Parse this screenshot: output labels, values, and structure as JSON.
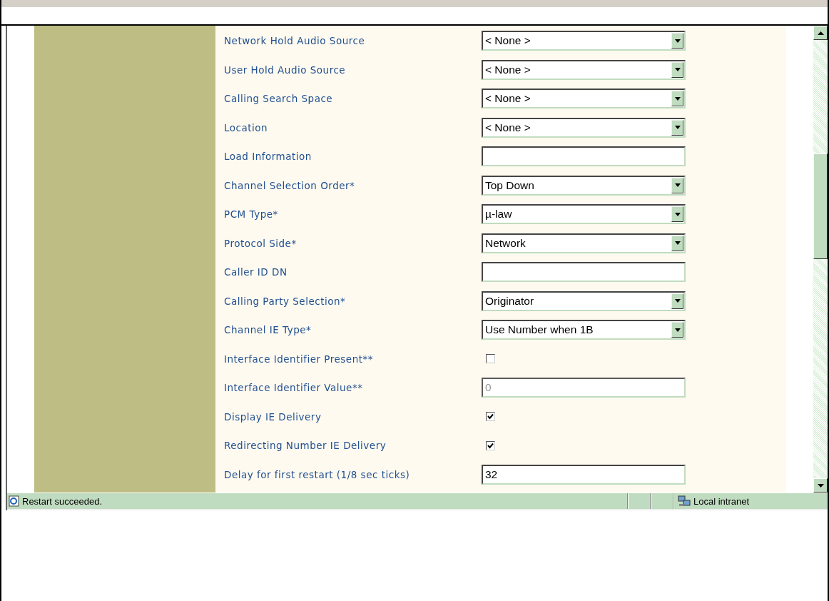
{
  "form": {
    "fields": [
      {
        "kind": "select",
        "label": "Network Hold Audio Source",
        "value": "< None >"
      },
      {
        "kind": "select",
        "label": "User Hold Audio Source",
        "value": "< None >"
      },
      {
        "kind": "select",
        "label": "Calling Search Space",
        "value": "< None >"
      },
      {
        "kind": "select",
        "label": "Location",
        "value": "< None >"
      },
      {
        "kind": "text",
        "label": "Load Information",
        "disabled": false
      },
      {
        "kind": "select",
        "label": "Channel Selection Order*",
        "value": "Top Down"
      },
      {
        "kind": "select",
        "label": "PCM Type*",
        "value": "µ-law"
      },
      {
        "kind": "select",
        "label": "Protocol Side*",
        "value": "Network"
      },
      {
        "kind": "text",
        "label": "Caller ID DN",
        "disabled": false
      },
      {
        "kind": "select",
        "label": "Calling Party Selection*",
        "value": "Originator"
      },
      {
        "kind": "select",
        "label": "Channel IE Type*",
        "value": "Use Number when 1B"
      },
      {
        "kind": "checkbox",
        "label": "Interface Identifier Present**",
        "checked": false
      },
      {
        "kind": "text",
        "label": "Interface Identifier Value**",
        "value": "0",
        "disabled": true
      },
      {
        "kind": "checkbox",
        "label": "Display IE Delivery",
        "checked": true
      },
      {
        "kind": "checkbox",
        "label": "Redirecting Number IE Delivery",
        "checked": true
      },
      {
        "kind": "text",
        "label": "Delay for first restart (1/8 sec ticks)",
        "value": "32",
        "disabled": false
      }
    ]
  },
  "status_bar": {
    "message": "Restart succeeded.",
    "zone": "Local intranet"
  }
}
